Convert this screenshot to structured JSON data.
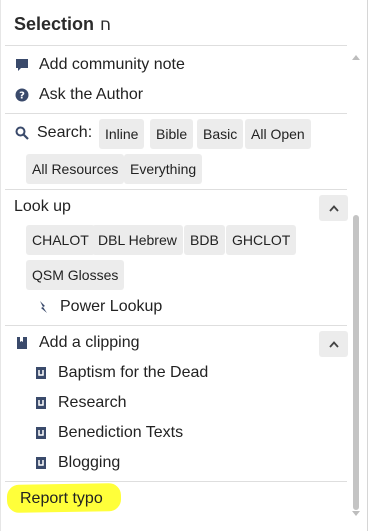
{
  "panel": {
    "title": "Selection",
    "title_symbol": "ח",
    "actions": [
      {
        "label": "Add community note",
        "icon": "comment-icon"
      },
      {
        "label": "Ask the Author",
        "icon": "question-circle-icon"
      }
    ],
    "search": {
      "label": "Search:",
      "chips": [
        "Inline",
        "Bible",
        "Basic",
        "All Open",
        "All Resources",
        "Everything"
      ]
    },
    "lookup": {
      "title": "Look up",
      "chips": [
        "CHALOT",
        "DBL Hebrew",
        "BDB",
        "GHCLOT",
        "QSM Glosses"
      ],
      "power_lookup": "Power Lookup"
    },
    "clipping": {
      "title": "Add a clipping",
      "items": [
        "Baptism for the Dead",
        "Research",
        "Benediction Texts",
        "Blogging"
      ]
    },
    "report_typo": "Report typo"
  },
  "colors": {
    "highlight": "#ffff3a",
    "chip_bg": "#ececec",
    "icon_blue": "#3a4a6b"
  }
}
